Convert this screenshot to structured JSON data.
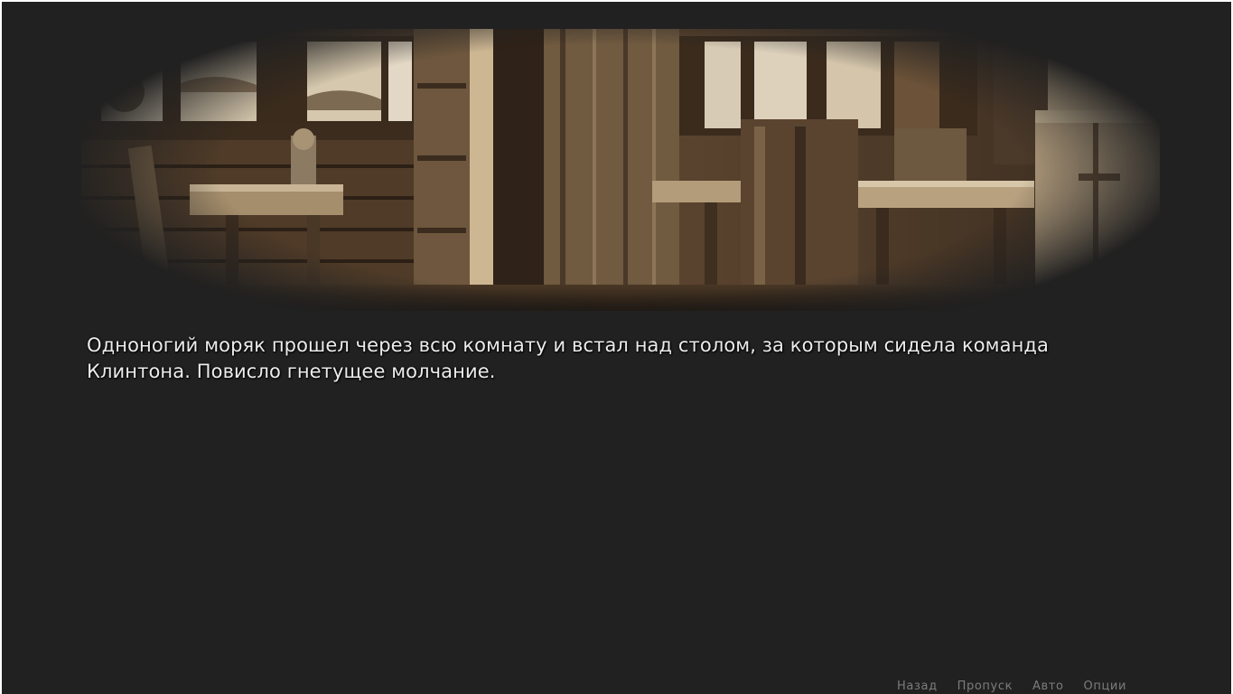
{
  "scene": {
    "background_icon": "sepia-tavern-interior-picture",
    "palette": {
      "dark": "#2a1f16",
      "mid": "#6b5034",
      "light": "#c8b08a",
      "window": "#e2d6c2"
    }
  },
  "dialogue": {
    "text": "Одноногий моряк прошел через всю комнату и встал над столом, за которым сидела команда Клинтона. Повисло гнетущее молчание."
  },
  "quick_menu": {
    "back": "Назад",
    "skip": "Пропуск",
    "auto": "Авто",
    "options": "Опции"
  }
}
